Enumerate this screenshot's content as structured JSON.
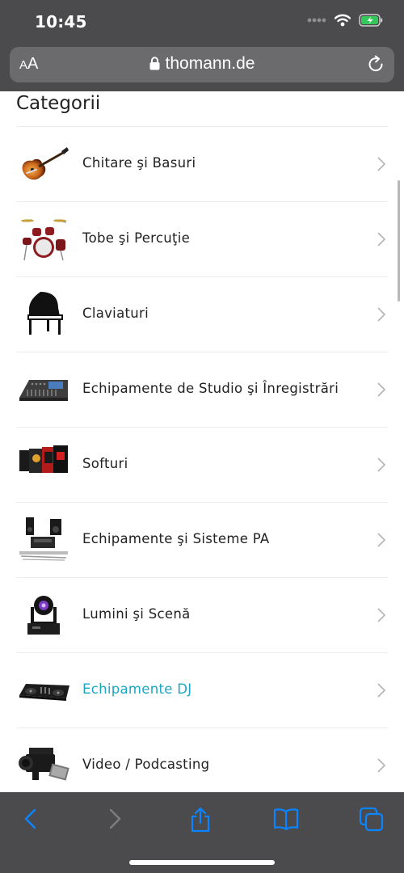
{
  "status_bar": {
    "time": "10:45",
    "icons": [
      "signal-dots-icon",
      "wifi-icon",
      "battery-charging-icon"
    ],
    "battery_color": "#34c759"
  },
  "address_bar": {
    "text_size_button": "AA",
    "url": "thomann.de",
    "icons": [
      "lock-icon",
      "reload-icon"
    ]
  },
  "page": {
    "heading": "Categorii",
    "categories": [
      {
        "label": "Chitare şi Basuri",
        "icon": "guitar-thumbnail"
      },
      {
        "label": "Tobe şi Percuţie",
        "icon": "drumkit-thumbnail"
      },
      {
        "label": "Claviaturi",
        "icon": "grand-piano-thumbnail"
      },
      {
        "label": "Echipamente de Studio şi Înregistrări",
        "icon": "mixing-console-thumbnail"
      },
      {
        "label": "Softuri",
        "icon": "software-boxes-thumbnail"
      },
      {
        "label": "Echipamente şi Sisteme PA",
        "icon": "pa-speakers-thumbnail"
      },
      {
        "label": "Lumini şi Scenă",
        "icon": "moving-head-light-thumbnail"
      },
      {
        "label": "Echipamente DJ",
        "icon": "dj-controller-thumbnail",
        "active": true
      },
      {
        "label": "Video / Podcasting",
        "icon": "video-camera-thumbnail"
      }
    ],
    "active_color": "#1aa7c4"
  },
  "toolbar": {
    "buttons": [
      "back-icon",
      "forward-icon",
      "share-icon",
      "bookmarks-icon",
      "tabs-icon"
    ],
    "accent": "#0a84ff"
  }
}
